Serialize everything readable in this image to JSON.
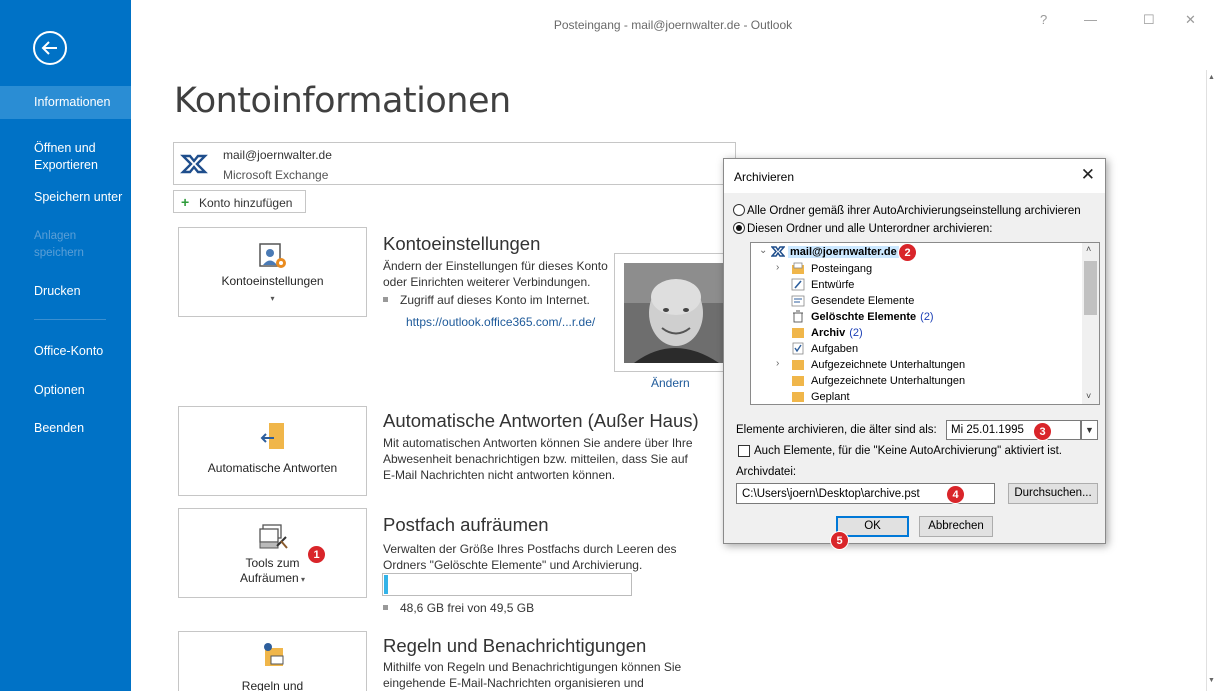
{
  "window": {
    "title": "Posteingang - mail@joernwalter.de - Outlook",
    "help": "?",
    "minimize": "—",
    "maximize": "☐",
    "close": "✕"
  },
  "sidebar": {
    "items": [
      {
        "label": "Informationen"
      },
      {
        "label": "Öffnen und Exportieren"
      },
      {
        "label": "Speichern unter"
      },
      {
        "label": "Anlagen speichern"
      },
      {
        "label": "Drucken"
      },
      {
        "label": "Office-Konto"
      },
      {
        "label": "Optionen"
      },
      {
        "label": "Beenden"
      }
    ]
  },
  "page": {
    "title": "Kontoinformationen"
  },
  "account": {
    "email": "mail@joernwalter.de",
    "type": "Microsoft Exchange",
    "add_label": "Konto hinzufügen"
  },
  "sections": {
    "settings": {
      "tile_label": "Kontoeinstellungen",
      "title": "Kontoeinstellungen",
      "desc": "Ändern der Einstellungen für dieses Konto oder Einrichten weiterer Verbindungen.",
      "bullet": "Zugriff auf dieses Konto im Internet.",
      "link": "https://outlook.office365.com/...r.de/",
      "photo_change": "Ändern"
    },
    "auto_reply": {
      "tile_label": "Automatische Antworten",
      "title": "Automatische Antworten (Außer Haus)",
      "desc": "Mit automatischen Antworten können Sie andere über Ihre Abwesenheit benachrichtigen bzw. mitteilen, dass Sie auf E-Mail Nachrichten nicht antworten können."
    },
    "cleanup": {
      "tile_label_1": "Tools zum",
      "tile_label_2": "Aufräumen",
      "title": "Postfach aufräumen",
      "desc": "Verwalten der Größe Ihres Postfachs durch Leeren des Ordners \"Gelöschte Elemente\" und Archivierung.",
      "storage_text": "48,6 GB frei von 49,5 GB",
      "storage_used_fraction": 0.018
    },
    "rules": {
      "tile_label": "Regeln und",
      "title": "Regeln und Benachrichtigungen",
      "desc": "Mithilfe von Regeln und Benachrichtigungen können Sie eingehende E-Mail-Nachrichten organisieren und"
    }
  },
  "dialog": {
    "title": "Archivieren",
    "close": "✕",
    "radio_all": "Alle Ordner gemäß ihrer AutoArchivierungseinstellung archivieren",
    "radio_this": "Diesen Ordner und alle Unterordner archivieren:",
    "tree": [
      {
        "label": "mail@joernwalter.de",
        "count": "",
        "bold": true,
        "arrow": "⌄",
        "indent": 0
      },
      {
        "label": "Posteingang",
        "count": "",
        "bold": false,
        "arrow": "›",
        "indent": 1
      },
      {
        "label": "Entwürfe",
        "count": "",
        "bold": false,
        "arrow": "",
        "indent": 1
      },
      {
        "label": "Gesendete Elemente",
        "count": "",
        "bold": false,
        "arrow": "",
        "indent": 1
      },
      {
        "label": "Gelöschte Elemente",
        "count": "(2)",
        "bold": true,
        "arrow": "",
        "indent": 1
      },
      {
        "label": "Archiv",
        "count": "(2)",
        "bold": true,
        "arrow": "",
        "indent": 1
      },
      {
        "label": "Aufgaben",
        "count": "",
        "bold": false,
        "arrow": "",
        "indent": 1
      },
      {
        "label": "Aufgezeichnete Unterhaltungen",
        "count": "",
        "bold": false,
        "arrow": "›",
        "indent": 1
      },
      {
        "label": "Aufgezeichnete Unterhaltungen",
        "count": "",
        "bold": false,
        "arrow": "",
        "indent": 1
      },
      {
        "label": "Geplant",
        "count": "",
        "bold": false,
        "arrow": "",
        "indent": 1
      }
    ],
    "older_label": "Elemente archivieren, die älter sind als:",
    "older_value": "Mi 25.01.1995",
    "no_auto_label": "Auch Elemente, für die \"Keine AutoArchivierung\" aktiviert ist.",
    "file_label": "Archivdatei:",
    "file_value": "C:\\Users\\joern\\Desktop\\archive.pst",
    "browse": "Durchsuchen...",
    "ok": "OK",
    "cancel": "Abbrechen"
  },
  "badges": [
    "1",
    "2",
    "3",
    "4",
    "5"
  ],
  "colors": {
    "sidebar": "#0072c6",
    "sidebar_active": "#2a8dd4",
    "badge": "#d9252a",
    "storage": "#33b3e8"
  }
}
